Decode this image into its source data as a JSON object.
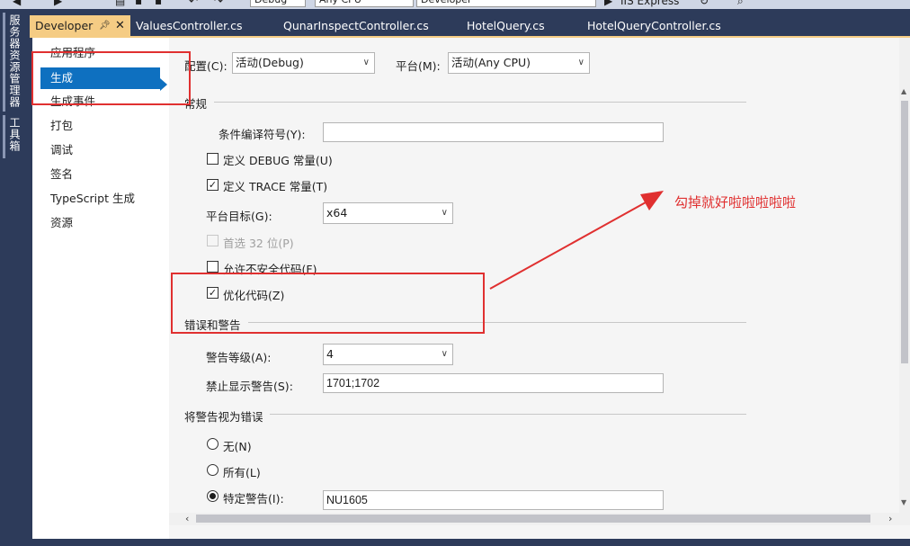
{
  "toolbar": {
    "config_combo": "Debug",
    "platform_combo": "Any CPU",
    "project_combo": "Developer",
    "run_label": "IIS Express"
  },
  "side_tools": {
    "server_explorer": "服务器资源管理器",
    "toolbox": "工具箱"
  },
  "tabs": [
    {
      "label": "Developer",
      "active": true
    },
    {
      "label": "ValuesController.cs"
    },
    {
      "label": "QunarInspectController.cs"
    },
    {
      "label": "HotelQuery.cs"
    },
    {
      "label": "HotelQueryController.cs"
    }
  ],
  "nav": {
    "items": [
      "应用程序",
      "生成",
      "生成事件",
      "打包",
      "调试",
      "签名",
      "TypeScript 生成",
      "资源"
    ],
    "selected": "生成"
  },
  "config_row": {
    "config_label": "配置(C):",
    "config_value": "活动(Debug)",
    "platform_label": "平台(M):",
    "platform_value": "活动(Any CPU)"
  },
  "general": {
    "title": "常规",
    "conditional_symbols_label": "条件编译符号(Y):",
    "conditional_symbols_value": "",
    "define_debug": {
      "label": "定义 DEBUG 常量(U)",
      "checked": false
    },
    "define_trace": {
      "label": "定义 TRACE 常量(T)",
      "checked": true
    },
    "platform_target_label": "平台目标(G):",
    "platform_target_value": "x64",
    "prefer32": {
      "label": "首选 32 位(P)",
      "checked": false,
      "disabled": true
    },
    "allow_unsafe": {
      "label": "允许不安全代码(F)",
      "checked": false
    },
    "optimize": {
      "label": "优化代码(Z)",
      "checked": true
    }
  },
  "errors": {
    "title": "错误和警告",
    "warning_level_label": "警告等级(A):",
    "warning_level_value": "4",
    "suppress_label": "禁止显示警告(S):",
    "suppress_value": "1701;1702"
  },
  "treat_as_errors": {
    "title": "将警告视为错误",
    "none": {
      "label": "无(N)",
      "selected": false
    },
    "all": {
      "label": "所有(L)",
      "selected": false
    },
    "specific": {
      "label": "特定警告(I):",
      "selected": true,
      "value": "NU1605"
    }
  },
  "annotation": {
    "text": "勾掉就好啦啦啦啦啦",
    "color": "#e03030"
  },
  "colors": {
    "accent": "#0e70c0",
    "active_tab": "#f5cc84",
    "chrome": "#2d3b5a"
  },
  "icons": {
    "check": "✓",
    "chevron": "chevron-down-icon",
    "pin": "pin-icon",
    "close": "close-icon"
  }
}
